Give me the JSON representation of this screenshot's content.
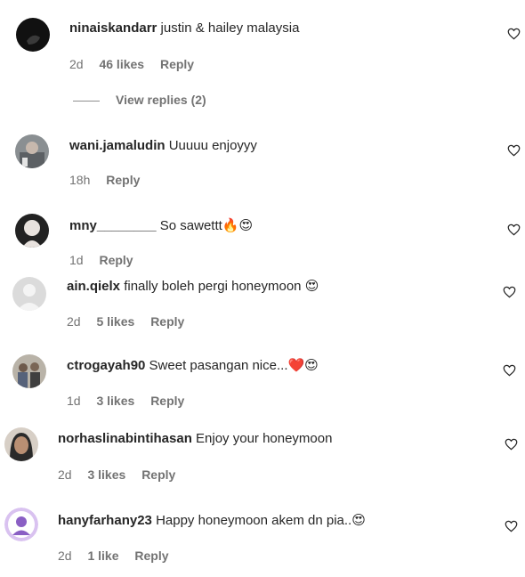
{
  "comments": [
    {
      "username": "ninaiskandarr",
      "text": "justin & hailey malaysia",
      "emoji": "",
      "time": "2d",
      "likes": "46 likes",
      "reply": "Reply",
      "view_replies": "View replies (2)"
    },
    {
      "username": "wani.jamaludin",
      "text": "Uuuuu enjoyyy",
      "emoji": "",
      "time": "18h",
      "likes": "",
      "reply": "Reply"
    },
    {
      "username": "mny________",
      "text": "So sawettt",
      "emoji": "🔥😍",
      "time": "1d",
      "likes": "",
      "reply": "Reply"
    },
    {
      "username": "ain.qielx",
      "text": "finally boleh pergi honeymoon",
      "emoji": "😍",
      "time": "2d",
      "likes": "5 likes",
      "reply": "Reply"
    },
    {
      "username": "ctrogayah90",
      "text": "Sweet pasangan nice...",
      "emoji": "❤️😍",
      "time": "1d",
      "likes": "3 likes",
      "reply": "Reply"
    },
    {
      "username": "norhaslinabintihasan",
      "text": "Enjoy your honeymoon",
      "emoji": "",
      "time": "2d",
      "likes": "3 likes",
      "reply": "Reply"
    },
    {
      "username": "hanyfarhany23",
      "text": "Happy honeymoon akem dn pia..",
      "emoji": "😍",
      "time": "2d",
      "likes": "1 like",
      "reply": "Reply"
    }
  ],
  "colors": {
    "text": "#262626",
    "meta": "#737373"
  }
}
